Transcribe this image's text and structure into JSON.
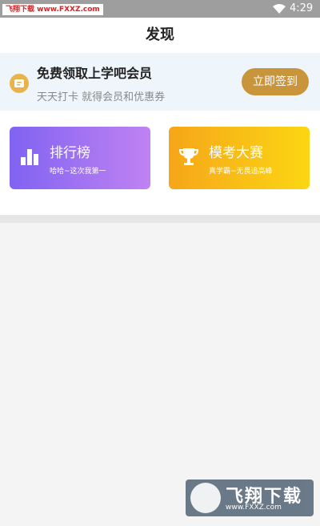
{
  "status_bar": {
    "watermark": "飞翔下载 www.FXXZ.com",
    "time": "4:29"
  },
  "header": {
    "title": "发现"
  },
  "checkin": {
    "title": "免费领取上学吧会员",
    "subtitle": "天天打卡 就得会员和优惠券",
    "button_label": "立即签到",
    "icon": "coupon-icon"
  },
  "cards": [
    {
      "title": "排行榜",
      "subtitle": "哈哈~这次我第一",
      "icon": "bar-chart-icon",
      "colors": [
        "#8063f2",
        "#c082f2"
      ]
    },
    {
      "title": "模考大赛",
      "subtitle": "真学霸~无畏追高峰",
      "icon": "trophy-icon",
      "colors": [
        "#f6a619",
        "#fbd614"
      ]
    }
  ],
  "bottom_watermark": {
    "text": "飞翔下载",
    "url": "www.FXXZ.com"
  },
  "colors": {
    "accent": "#c9953a",
    "banner_bg": "#eef6fb"
  }
}
